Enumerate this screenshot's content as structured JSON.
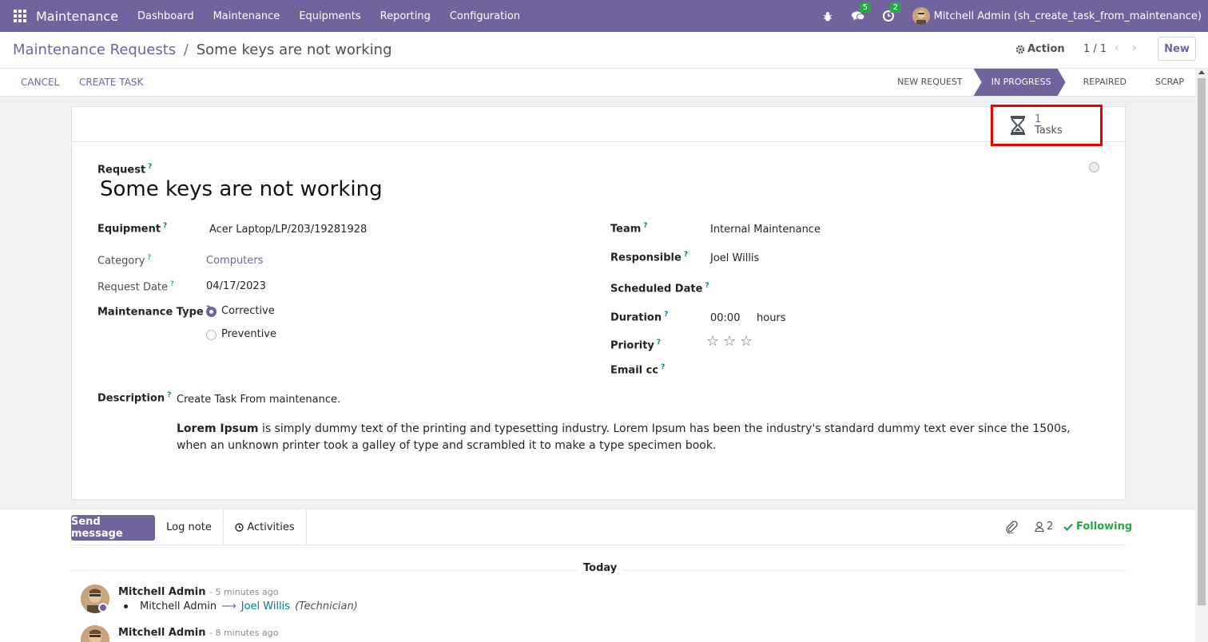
{
  "navbar": {
    "app_name": "Maintenance",
    "menu": [
      "Dashboard",
      "Maintenance",
      "Equipments",
      "Reporting",
      "Configuration"
    ],
    "messages_count": "5",
    "activities_count": "2",
    "user": "Mitchell Admin (sh_create_task_from_maintenance)"
  },
  "breadcrumb": {
    "parent": "Maintenance Requests",
    "separator": "/",
    "current": "Some keys are not working"
  },
  "control": {
    "action_label": "Action",
    "pager": "1 / 1",
    "new_label": "New"
  },
  "statusbar": {
    "cancel_label": "CANCEL",
    "create_task_label": "CREATE TASK",
    "stages": [
      "NEW REQUEST",
      "IN PROGRESS",
      "REPAIRED",
      "SCRAP"
    ],
    "active_stage": "IN PROGRESS"
  },
  "smart_button": {
    "count": "1",
    "label": "Tasks"
  },
  "form": {
    "request_label": "Request",
    "title": "Some keys are not working",
    "help_mark": "?",
    "left": {
      "equipment_label": "Equipment",
      "equipment_value": "Acer Laptop/LP/203/19281928",
      "category_label": "Category",
      "category_value": "Computers",
      "request_date_label": "Request Date",
      "request_date_value": "04/17/2023",
      "maintenance_type_label": "Maintenance Type",
      "type_options": [
        "Corrective",
        "Preventive"
      ],
      "type_selected": "Corrective"
    },
    "right": {
      "team_label": "Team",
      "team_value": "Internal Maintenance",
      "responsible_label": "Responsible",
      "responsible_value": "Joel Willis",
      "scheduled_date_label": "Scheduled Date",
      "duration_label": "Duration",
      "duration_value": "00:00",
      "duration_unit": "hours",
      "priority_label": "Priority",
      "priority_stars": 0,
      "priority_max": 3,
      "email_cc_label": "Email cc"
    },
    "description_label": "Description",
    "description_line1": "Create Task From maintenance.",
    "description_bold": "Lorem Ipsum",
    "description_rest": " is simply dummy text of the printing and typesetting industry. Lorem Ipsum has been the industry's standard dummy text ever since the 1500s, when an unknown printer took a galley of type and scrambled it to make a type specimen book."
  },
  "chatter": {
    "send_message": "Send message",
    "log_note": "Log note",
    "activities": "Activities",
    "followers_count": "2",
    "following_label": "Following",
    "date_separator": "Today",
    "messages": [
      {
        "author": "Mitchell Admin",
        "time": "- 5 minutes ago",
        "old_value": "Mitchell Admin",
        "new_value": "Joel Willis",
        "field": "(Technician)"
      },
      {
        "author": "Mitchell Admin",
        "time": "- 8 minutes ago"
      }
    ]
  },
  "colors": {
    "brand": "#71639e",
    "highlight_border": "#ee0000",
    "following": "#28a745"
  }
}
